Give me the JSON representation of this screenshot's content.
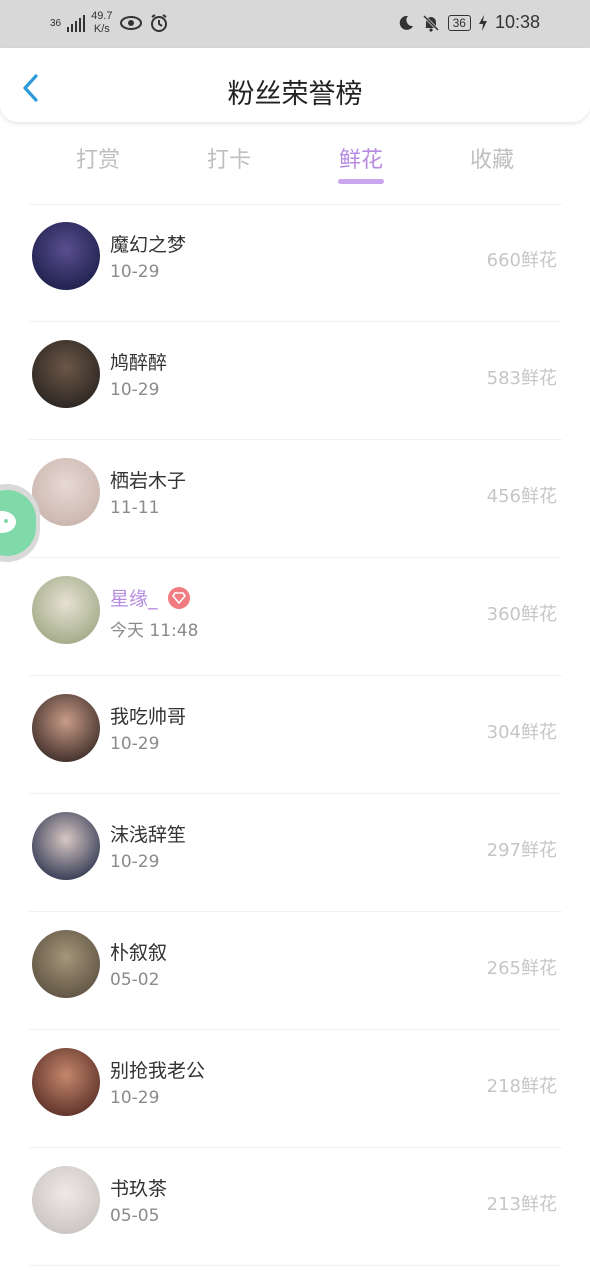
{
  "status_bar": {
    "network": "36",
    "speed_value": "49.7",
    "speed_unit": "K/s",
    "battery": "36",
    "time": "10:38"
  },
  "header": {
    "title": "粉丝荣誉榜"
  },
  "tabs": [
    {
      "label": "打赏",
      "active": false
    },
    {
      "label": "打卡",
      "active": false
    },
    {
      "label": "鲜花",
      "active": true
    },
    {
      "label": "收藏",
      "active": false
    }
  ],
  "rows": [
    {
      "name": "魔幻之梦",
      "date": "10-29",
      "count": "660鲜花",
      "avatar_colors": [
        "#1b1f4a",
        "#5a4e8f"
      ]
    },
    {
      "name": "鸠醉醉",
      "date": "10-29",
      "count": "583鲜花",
      "avatar_colors": [
        "#2a2420",
        "#6b5748"
      ]
    },
    {
      "name": "栖岩木子",
      "date": "11-11",
      "count": "456鲜花",
      "avatar_colors": [
        "#c9b4ad",
        "#e7d9d3"
      ]
    },
    {
      "name": "星缘_",
      "date": "今天 11:48",
      "count": "360鲜花",
      "avatar_colors": [
        "#9fa884",
        "#e6e1d3"
      ],
      "vip": true
    },
    {
      "name": "我吃帅哥",
      "date": "10-29",
      "count": "304鲜花",
      "avatar_colors": [
        "#3a2a26",
        "#c99c88"
      ]
    },
    {
      "name": "沫浅辞笙",
      "date": "10-29",
      "count": "297鲜花",
      "avatar_colors": [
        "#2e3650",
        "#d8c7c4"
      ]
    },
    {
      "name": "朴叙叙",
      "date": "05-02",
      "count": "265鲜花",
      "avatar_colors": [
        "#5d5142",
        "#a39679"
      ]
    },
    {
      "name": "别抢我老公",
      "date": "10-29",
      "count": "218鲜花",
      "avatar_colors": [
        "#5a2e26",
        "#c4876c"
      ]
    },
    {
      "name": "书玖茶",
      "date": "05-05",
      "count": "213鲜花",
      "avatar_colors": [
        "#c8c3c1",
        "#efe8e6"
      ]
    }
  ],
  "colors": {
    "accent": "#b68be0",
    "back_arrow": "#2b9ad6",
    "vip_badge": "#f07b80"
  }
}
